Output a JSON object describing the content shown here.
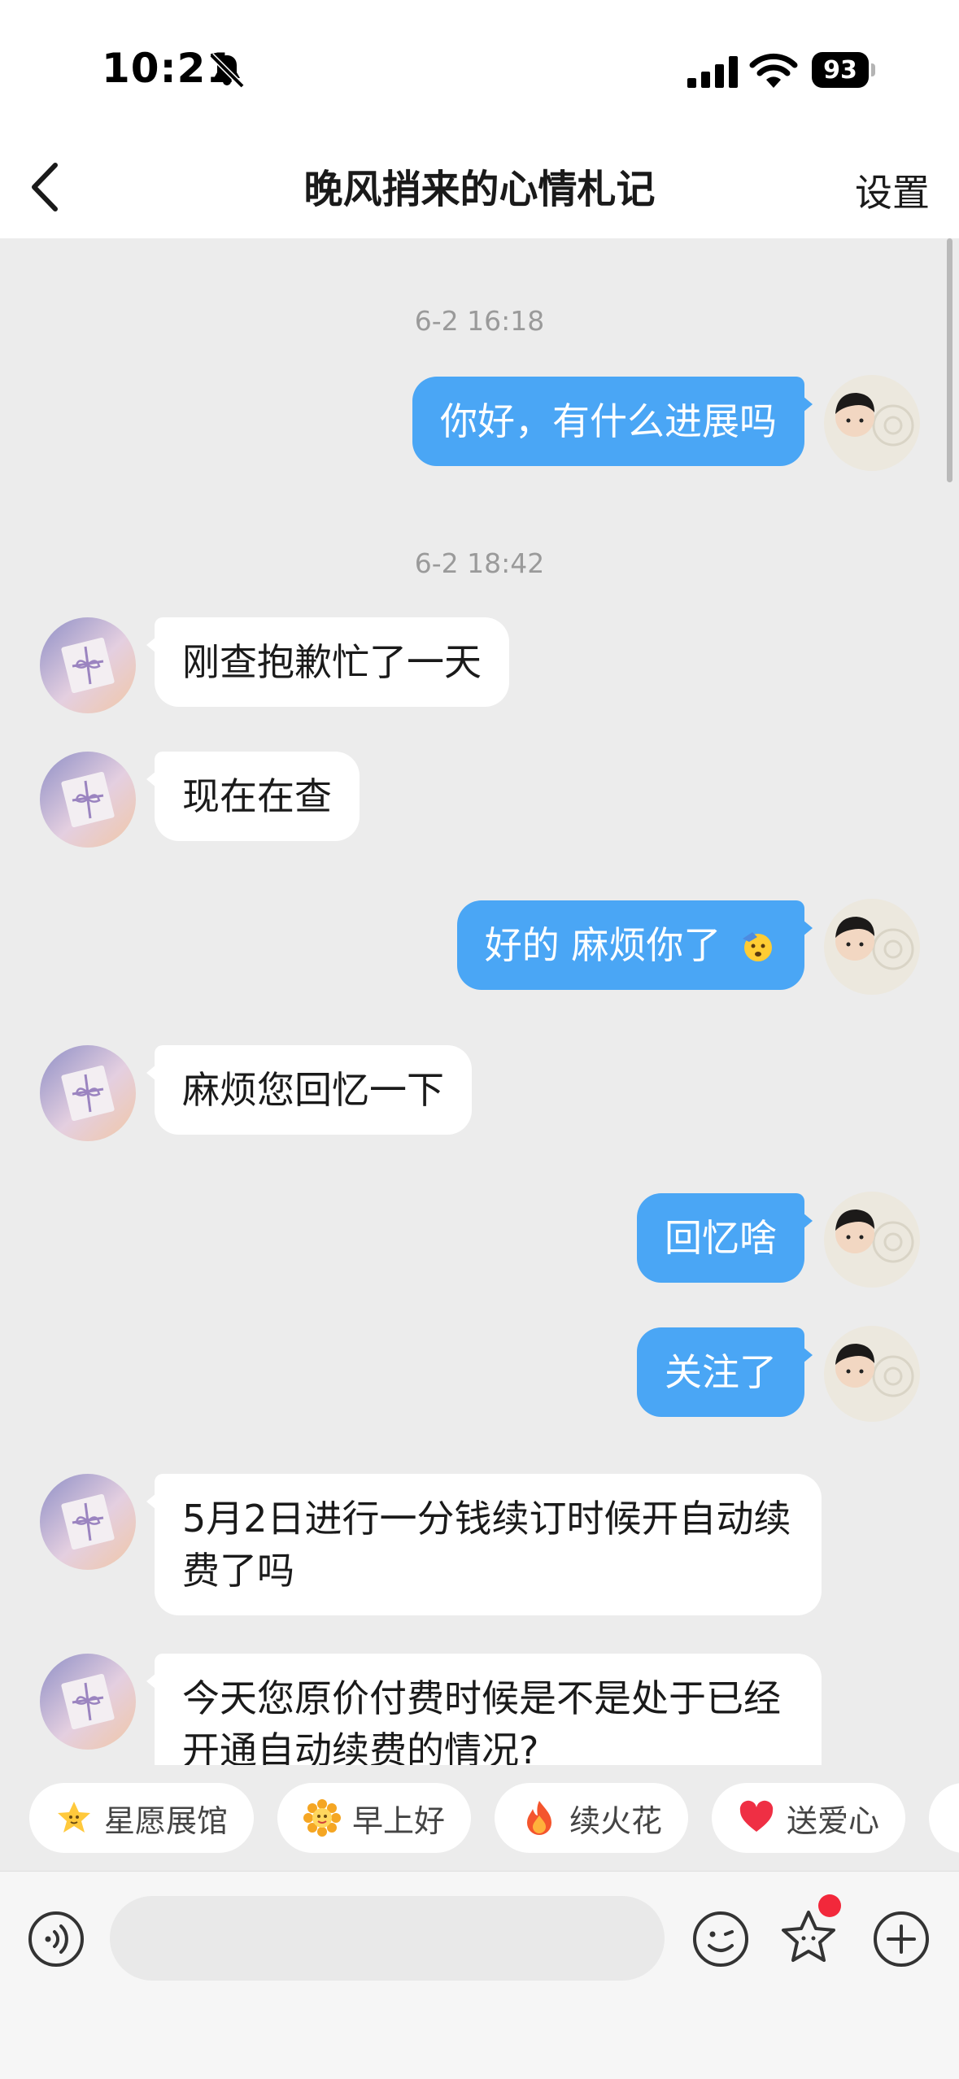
{
  "status_bar": {
    "time": "10:21",
    "battery": "93",
    "icons": [
      "bell-slash-icon",
      "signal-icon",
      "wifi-icon",
      "battery-icon"
    ]
  },
  "nav": {
    "title": "晚风捎来的心情札记",
    "settings_label": "设置",
    "back_icon": "chevron-left-icon"
  },
  "chat": {
    "timestamps": [
      "6-2 16:18",
      "6-2 18:42"
    ],
    "messages": [
      {
        "side": "out",
        "text": "你好，有什么进展吗"
      },
      {
        "side": "in",
        "text": "刚查抱歉忙了一天"
      },
      {
        "side": "in",
        "text": "现在在查"
      },
      {
        "side": "out",
        "text": "好的 麻烦你了",
        "emoji": "saluting-face-icon"
      },
      {
        "side": "in",
        "text": "麻烦您回忆一下"
      },
      {
        "side": "out",
        "text": "回忆啥"
      },
      {
        "side": "out",
        "text": "关注了"
      },
      {
        "side": "in",
        "text": "5月2日进行一分钱续订时候开自动续费了吗"
      },
      {
        "side": "in",
        "text": "今天您原价付费时候是不是处于已经开通自动续费的情况?"
      }
    ]
  },
  "chips": [
    {
      "label": "星愿展馆",
      "icon": "star-face-icon"
    },
    {
      "label": "早上好",
      "icon": "sunflower-face-icon"
    },
    {
      "label": "续火花",
      "icon": "fire-icon"
    },
    {
      "label": "送爱心",
      "icon": "heart-icon"
    }
  ],
  "input": {
    "placeholder": "",
    "left_icon": "voice-icon",
    "right_icons": [
      "emoji-icon",
      "star-icon",
      "plus-icon"
    ]
  },
  "colors": {
    "outgoing_bubble": "#4aa6f5",
    "incoming_bubble": "#ffffff",
    "background": "#ececec",
    "notification_dot": "#f2283b"
  }
}
